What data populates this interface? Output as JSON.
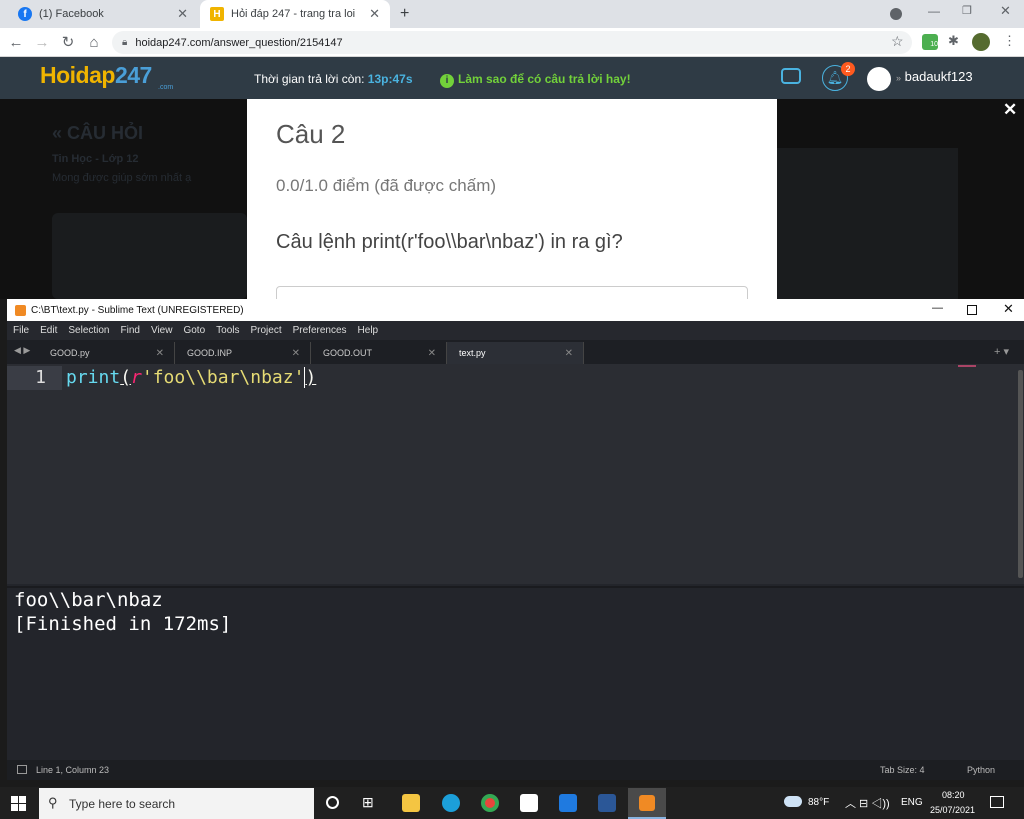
{
  "browser": {
    "tabs": [
      {
        "label": "(1) Facebook",
        "close": "✕"
      },
      {
        "label": "Hỏi đáp 247 - trang tra loi",
        "close": "✕"
      }
    ],
    "new_tab": "+",
    "url": "hoidap247.com/answer_question/2154147",
    "ext_badge": "10"
  },
  "site": {
    "logo_text": "Hoidap",
    "logo_num": "247",
    "logo_sub": ".com",
    "timer_label": "Thời gian trả lời còn:",
    "timer_value": "13p:47s",
    "tip": "Làm sao để có câu trả lời hay!",
    "notif_count": "2",
    "username": "badaukf123",
    "page_heading": "« CÂU HỎI",
    "subject": "Tin Học - Lớp 12",
    "request": "Mong được giúp sớm nhất ạ"
  },
  "modal": {
    "title": "Câu 2",
    "score": "0.0/1.0 điểm (đã được chấm)",
    "question": "Câu lệnh print(r'foo\\\\bar\\nbaz') in ra gì?",
    "close": "✕"
  },
  "sublime": {
    "title": "C:\\BT\\text.py - Sublime Text (UNREGISTERED)",
    "menu": [
      "File",
      "Edit",
      "Selection",
      "Find",
      "View",
      "Goto",
      "Tools",
      "Project",
      "Preferences",
      "Help"
    ],
    "tabs": [
      {
        "label": "GOOD.py"
      },
      {
        "label": "GOOD.INP"
      },
      {
        "label": "GOOD.OUT"
      },
      {
        "label": "text.py"
      }
    ],
    "line_number": "1",
    "code": {
      "fn": "print",
      "open": "(",
      "prefix": "r",
      "quote_open": "'",
      "body": "foo\\\\bar\\nbaz",
      "quote_close": "'",
      "close": ")"
    },
    "output": [
      "foo\\\\bar\\nbaz",
      "[Finished in 172ms]"
    ],
    "status_left": "Line 1, Column 23",
    "tab_size": "Tab Size: 4",
    "syntax": "Python"
  },
  "taskbar": {
    "search_placeholder": "Type here to search",
    "weather": "88°F",
    "lang": "ENG",
    "time": "08:20",
    "date": "25/07/2021"
  }
}
